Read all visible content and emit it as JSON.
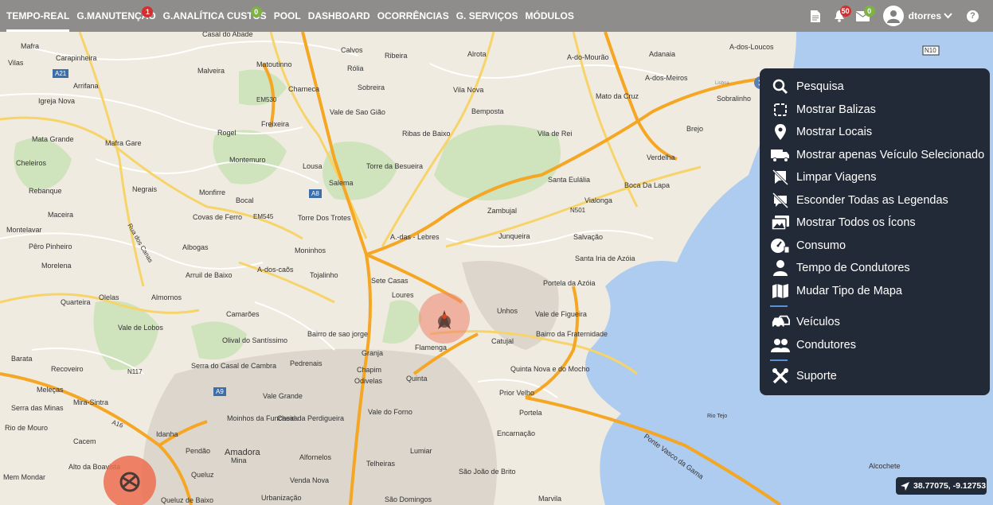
{
  "nav": {
    "items": [
      {
        "label": "TEMPO-REAL",
        "active": true
      },
      {
        "label": "G.MANUTENÇÃO",
        "badge": "1",
        "badge_color": "red"
      },
      {
        "label": "G.ANALÍTICA CUSTOS",
        "badge": "0",
        "badge_color": "green"
      },
      {
        "label": "POOL"
      },
      {
        "label": "DASHBOARD"
      },
      {
        "label": "OCORRÊNCIAS"
      },
      {
        "label": "G. SERVIÇOS"
      },
      {
        "label": "MÓDULOS"
      }
    ]
  },
  "topright": {
    "document_icon": "document-icon",
    "notifications_badge": "50",
    "messages_badge": "0",
    "username": "dtorres",
    "help": "?"
  },
  "menu": {
    "items": [
      {
        "label": "Pesquisa",
        "icon": "search-icon"
      },
      {
        "label": "Mostrar Balizas",
        "icon": "beacon-icon"
      },
      {
        "label": "Mostrar Locais",
        "icon": "location-pin-icon"
      },
      {
        "label": "Mostrar apenas Veículo Selecionado",
        "icon": "truck-icon"
      },
      {
        "label": "Limpar Viagens",
        "icon": "clear-trips-icon"
      },
      {
        "label": "Esconder Todas as Legendas",
        "icon": "hide-labels-icon"
      },
      {
        "label": "Mostrar Todos os Ícons",
        "icon": "images-icon"
      },
      {
        "label": "Consumo",
        "icon": "fuel-gauge-icon"
      },
      {
        "label": "Tempo de Condutores",
        "icon": "driver-icon"
      },
      {
        "label": "Mudar Tipo de Mapa",
        "icon": "map-icon"
      },
      {
        "label": "Veículos",
        "icon": "car-icon"
      },
      {
        "label": "Condutores",
        "icon": "drivers-group-icon"
      },
      {
        "label": "Suporte",
        "icon": "tools-icon"
      }
    ]
  },
  "coords": "38.77075, -9.12753",
  "map": {
    "labels": [
      "Mafra",
      "Vilas",
      "Carapinheira",
      "Arrifana",
      "Igreja Nova",
      "Mata Grande",
      "Mafra Gare",
      "Cheleiros",
      "Rebanque",
      "Negrais",
      "Montelavar",
      "Maceira",
      "Pêro Pinheiro",
      "Morelena",
      "Quarteira",
      "Olelas",
      "Almornos",
      "Vale de Lobos",
      "Barata",
      "Recoveiro",
      "Meleças",
      "Serra das Minas",
      "Mira-Sintra",
      "Rio de Mouro",
      "Cacem",
      "Alto da Boavista",
      "Mem Mondar",
      "Casal do Abade",
      "Malveira",
      "Matoutinno",
      "Calvos",
      "Ribeira",
      "Alrota",
      "A-do-Mourão",
      "Adanaia",
      "A-dos-Loucos",
      "Rólia",
      "Sobreira",
      "Vila Nova",
      "A-dos-Meiros",
      "Charneca",
      "Vale de Sao Gião",
      "Mato da Cruz",
      "Sobralinho",
      "Bemposta",
      "Freixeira",
      "Rogel",
      "Ribas de Baixo",
      "Vila de Rei",
      "Brejo",
      "Verdelha",
      "Montemuro",
      "Lousa",
      "Torre da Besueira",
      "Salema",
      "Santa Eulália",
      "Boca Da Lapa",
      "Monfirre",
      "Bocal",
      "Covas de Ferro",
      "Torre Dos Trotes",
      "Zambujal",
      "Vialonga",
      "A.-das - Lebres",
      "Junqueira",
      "Salvação",
      "Albogas",
      "Moninhos",
      "Arruil de Baixo",
      "A-dos-caõs",
      "Tojalinho",
      "Sete Casas",
      "Loures",
      "Santa Iria de Azóia",
      "Portela da Azóia",
      "Unhos",
      "Vale de Figueira",
      "Camarões",
      "Olival do Santíssimo",
      "Bairro de sao jorge",
      "Catujal",
      "Bairro da Fraternidade",
      "Pedrenais",
      "Granja",
      "Flamenga",
      "Serra do Casal de Cambra",
      "Chapim",
      "Odivelas",
      "Quinta",
      "Quinta Nova e do Mocho",
      "Prior Velho",
      "Vale Grande",
      "Vale do Forno",
      "Portela",
      "Encarnação",
      "Rio Tejo",
      "Idanha",
      "Moinhos da Funcheira",
      "Casal da Perdigueira",
      "Pendão",
      "Amadora",
      "Mina",
      "Alfornelos",
      "Lumiar",
      "Telheiras",
      "Queluz",
      "Venda Nova",
      "São João de Brito",
      "Queluz de Baixo",
      "Urbanização",
      "São Domingos",
      "Marvila",
      "Alcochete",
      "Ponte Vasco da Gama",
      "Lisboa"
    ],
    "roads": [
      "A21",
      "EM530",
      "A8",
      "EM545",
      "N501",
      "N10",
      "N117",
      "A9",
      "A16",
      "Rua dos Canas"
    ]
  }
}
